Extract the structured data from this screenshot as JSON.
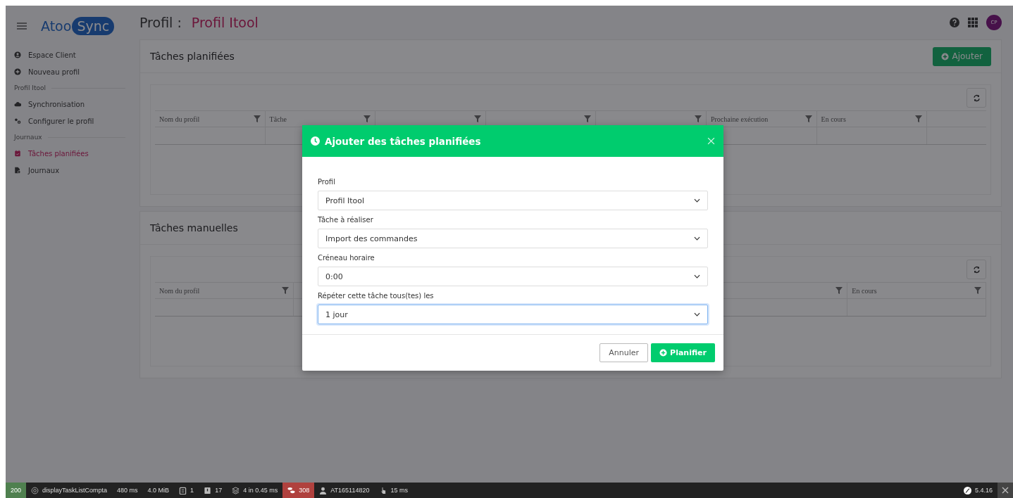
{
  "header": {
    "brand_left": "Atoo",
    "brand_right": "Sync",
    "title_label": "Profil :",
    "title_value": "Profil Itool",
    "avatar": "CP"
  },
  "sidebar": {
    "groups": [
      {
        "items": [
          {
            "label": "Espace Client",
            "kind": "user",
            "selected": false
          },
          {
            "label": "Nouveau profil",
            "kind": "plus",
            "selected": false
          }
        ]
      },
      {
        "heading": "Profil Itool",
        "items": [
          {
            "label": "Synchronisation",
            "kind": "cloud",
            "selected": false
          },
          {
            "label": "Configurer le profil",
            "kind": "gears",
            "selected": false
          }
        ]
      },
      {
        "heading": "Journaux",
        "items": [
          {
            "label": "Tâches planifiées",
            "kind": "calendar",
            "selected": true
          },
          {
            "label": "Journaux",
            "kind": "file",
            "selected": false
          }
        ]
      }
    ]
  },
  "panels": [
    {
      "title": "Tâches planifiées",
      "add_button": "Ajouter",
      "columns": [
        "Nom du profil",
        "Tâche",
        null,
        null,
        null,
        "Prochaine exécution",
        "En cours"
      ]
    },
    {
      "title": "Tâches manuelles",
      "columns": [
        "Nom du profil",
        null,
        null,
        null,
        null,
        "En cours"
      ]
    }
  ],
  "modal": {
    "title": "Ajouter des tâches planifiées",
    "fields": [
      {
        "label": "Profil",
        "value": "Profil Itool",
        "focused": false
      },
      {
        "label": "Tâche à réaliser",
        "value": "Import des commandes",
        "focused": false
      },
      {
        "label": "Créneau horaire",
        "value": "0:00",
        "focused": false
      },
      {
        "label": "Répéter cette tâche tous(tes) les",
        "value": "1 jour",
        "focused": true
      }
    ],
    "cancel_button": "Annuler",
    "submit_button": "Planifier"
  },
  "status_bar": {
    "items": [
      {
        "kind": "status",
        "text": "200"
      },
      {
        "kind": "route",
        "text": "displayTaskListCompta"
      },
      {
        "kind": "plain",
        "text": "480 ms"
      },
      {
        "kind": "plain",
        "text": "4.0 MiB"
      },
      {
        "kind": "forms",
        "text": "1"
      },
      {
        "kind": "logs",
        "text": "17"
      },
      {
        "kind": "cache",
        "text": "4 in 0.45 ms"
      },
      {
        "kind": "queries",
        "text": "308"
      },
      {
        "kind": "user",
        "text": "AT165114820"
      },
      {
        "kind": "time",
        "text": "15 ms"
      }
    ],
    "version": "5.4.16"
  }
}
